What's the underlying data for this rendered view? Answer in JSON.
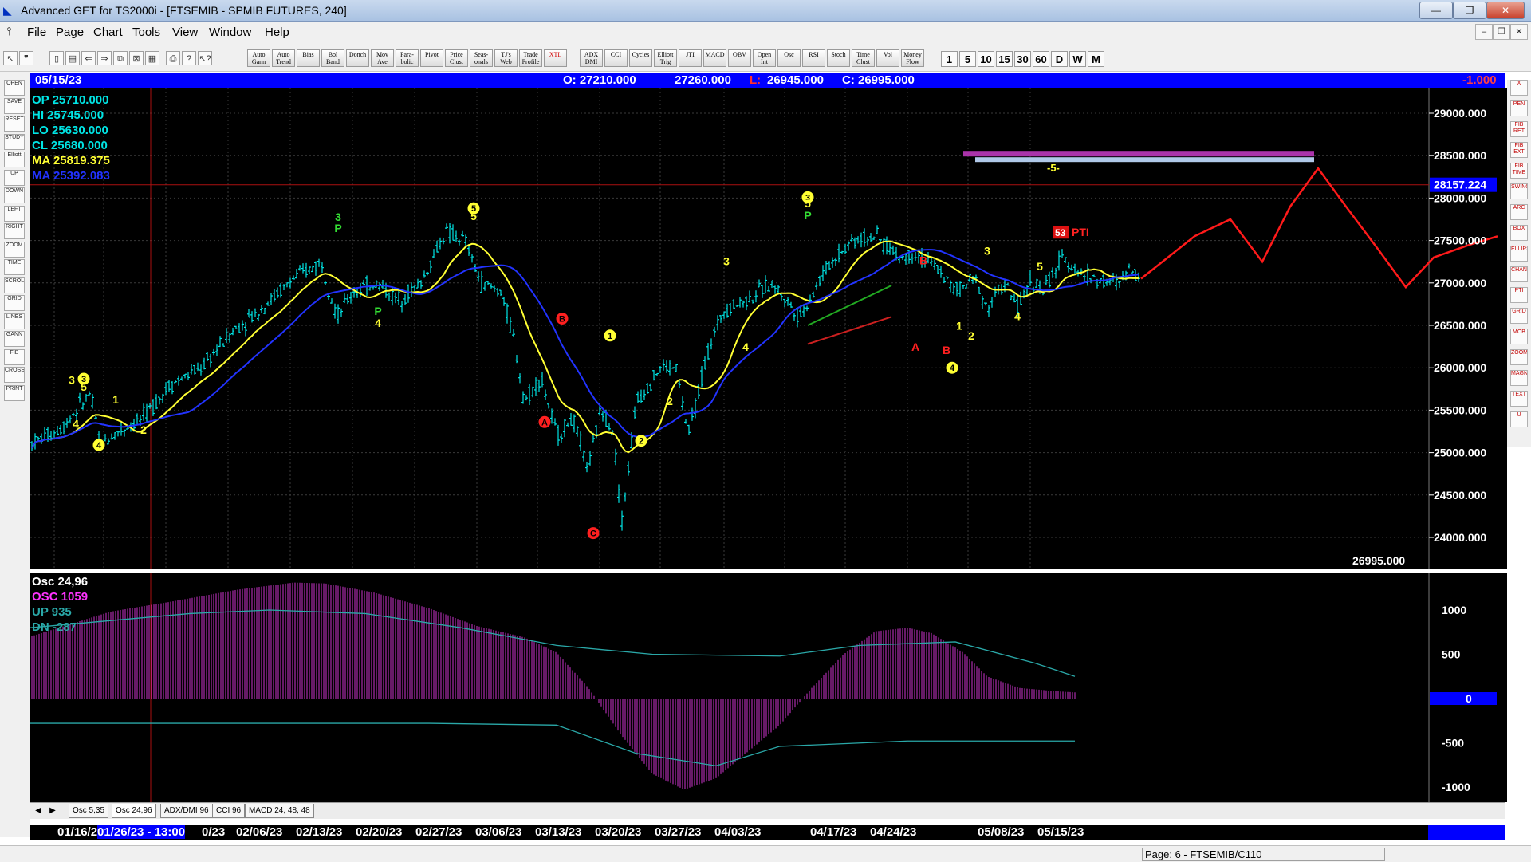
{
  "window": {
    "title": "Advanced GET for TS2000i - [FTSEMIB - SPMIB FUTURES, 240]",
    "minimize": "—",
    "maximize": "❐",
    "close": "✕"
  },
  "menu": [
    "File",
    "Page",
    "Chart",
    "Tools",
    "View",
    "Window",
    "Help"
  ],
  "toolbar": {
    "study_buttons": [
      "Auto Gann",
      "Auto Trend",
      "Bias",
      "Bol Band",
      "Donch",
      "Mov Ave",
      "Para-bolic",
      "Pivot",
      "Price Clust",
      "Seas-onals",
      "TJ's Web",
      "Trade Profile",
      "XTL",
      "ADX DMI",
      "CCI",
      "Cycles",
      "Elliott Trig",
      "JTI",
      "MACD",
      "OBV",
      "Open Int",
      "Osc",
      "RSI",
      "Stoch",
      "Time Clust",
      "Vol",
      "Money Flow"
    ],
    "timeframes": [
      "1",
      "5",
      "10",
      "15",
      "30",
      "60",
      "D",
      "W",
      "M"
    ]
  },
  "left_tools": [
    "OPEN",
    "SAVE",
    "RESET",
    "STUDY",
    "Elliott",
    "UP",
    "DOWN",
    "LEFT",
    "RIGHT",
    "ZOOM",
    "TIME",
    "SCROLL",
    "GRID",
    "LINES",
    "GANN",
    "FIB",
    "CROSS",
    "PRINT"
  ],
  "right_tools": [
    "X",
    "PEN",
    "FIB RET",
    "FIB EXT",
    "FIB TIME",
    "SWING",
    "ARC",
    "BOX",
    "ELLIPS",
    "CHAN",
    "PTI",
    "GRID",
    "MOB",
    "ZOOM",
    "MAGNET",
    "TEXT",
    "U"
  ],
  "header": {
    "date": "05/15/23",
    "open": "O: 27210.000",
    "high": "27260.000",
    "low_label": "L:",
    "low": "26945.000",
    "close": "C: 26995.000",
    "change": "-1.000"
  },
  "legend": {
    "op": "OP  25710.000",
    "hi": "HI   25745.000",
    "lo": "LO  25630.000",
    "cl": "CL  25680.000",
    "ma1": "MA  25819.375",
    "ma2": "MA  25392.083"
  },
  "colors": {
    "background": "#000000",
    "price_bars": "#00e5e5",
    "ma_fast": "#ffff33",
    "ma_slow": "#2233ff",
    "projection": "#ff1a1a",
    "oscillator": "#cc33cc",
    "header": "#0000ff"
  },
  "price_axis": {
    "labels": [
      "29000.000",
      "28500.000",
      "28000.000",
      "27500.000",
      "27000.000",
      "26500.000",
      "26000.000",
      "25500.000",
      "25000.000",
      "24500.000",
      "24000.000"
    ],
    "current_marker": "28157.224",
    "last_close": "26995.000"
  },
  "wave_labels": {
    "green": [
      "3",
      "P",
      "4",
      "P",
      "5",
      "5",
      "P"
    ],
    "yellow": [
      "3",
      "3",
      "5",
      "4",
      "1",
      "2",
      "4",
      "5",
      "5",
      "1",
      "2",
      "3",
      "4",
      "3",
      "5",
      "1",
      "2",
      "4",
      "3",
      "4",
      "5"
    ],
    "red": [
      "A",
      "B",
      "C",
      "A",
      "B"
    ],
    "projection_tag": "-5-",
    "pti_value": "53",
    "pti_label": "PTI"
  },
  "oscillator": {
    "legend": {
      "title": "Osc 24,96",
      "osc": "OSC 1059",
      "up": "UP   935",
      "dn": "DN   -287"
    },
    "axis": [
      "1000",
      "500",
      "0",
      "-500",
      "-1000"
    ]
  },
  "sheet_tabs": [
    "Osc 5,35",
    "Osc 24,96",
    "ADX/DMI 96",
    "CCI 96",
    "MACD 24, 48, 48"
  ],
  "dates": [
    "01/16/2",
    "01/26/23 - 13:00",
    "0/23",
    "02/06/23",
    "02/13/23",
    "02/20/23",
    "02/27/23",
    "03/06/23",
    "03/13/23",
    "03/20/23",
    "03/27/23",
    "04/03/23",
    "04/17/23",
    "04/24/23",
    "05/08/23",
    "05/15/23"
  ],
  "status": {
    "page": "Page: 6 - FTSEMIB/C110"
  }
}
